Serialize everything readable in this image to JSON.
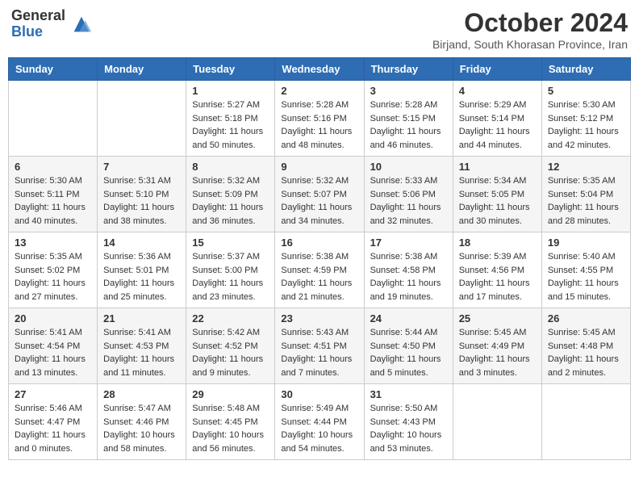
{
  "header": {
    "logo_general": "General",
    "logo_blue": "Blue",
    "month_title": "October 2024",
    "subtitle": "Birjand, South Khorasan Province, Iran"
  },
  "days_of_week": [
    "Sunday",
    "Monday",
    "Tuesday",
    "Wednesday",
    "Thursday",
    "Friday",
    "Saturday"
  ],
  "weeks": [
    [
      {
        "day": "",
        "info": ""
      },
      {
        "day": "",
        "info": ""
      },
      {
        "day": "1",
        "info": "Sunrise: 5:27 AM\nSunset: 5:18 PM\nDaylight: 11 hours and 50 minutes."
      },
      {
        "day": "2",
        "info": "Sunrise: 5:28 AM\nSunset: 5:16 PM\nDaylight: 11 hours and 48 minutes."
      },
      {
        "day": "3",
        "info": "Sunrise: 5:28 AM\nSunset: 5:15 PM\nDaylight: 11 hours and 46 minutes."
      },
      {
        "day": "4",
        "info": "Sunrise: 5:29 AM\nSunset: 5:14 PM\nDaylight: 11 hours and 44 minutes."
      },
      {
        "day": "5",
        "info": "Sunrise: 5:30 AM\nSunset: 5:12 PM\nDaylight: 11 hours and 42 minutes."
      }
    ],
    [
      {
        "day": "6",
        "info": "Sunrise: 5:30 AM\nSunset: 5:11 PM\nDaylight: 11 hours and 40 minutes."
      },
      {
        "day": "7",
        "info": "Sunrise: 5:31 AM\nSunset: 5:10 PM\nDaylight: 11 hours and 38 minutes."
      },
      {
        "day": "8",
        "info": "Sunrise: 5:32 AM\nSunset: 5:09 PM\nDaylight: 11 hours and 36 minutes."
      },
      {
        "day": "9",
        "info": "Sunrise: 5:32 AM\nSunset: 5:07 PM\nDaylight: 11 hours and 34 minutes."
      },
      {
        "day": "10",
        "info": "Sunrise: 5:33 AM\nSunset: 5:06 PM\nDaylight: 11 hours and 32 minutes."
      },
      {
        "day": "11",
        "info": "Sunrise: 5:34 AM\nSunset: 5:05 PM\nDaylight: 11 hours and 30 minutes."
      },
      {
        "day": "12",
        "info": "Sunrise: 5:35 AM\nSunset: 5:04 PM\nDaylight: 11 hours and 28 minutes."
      }
    ],
    [
      {
        "day": "13",
        "info": "Sunrise: 5:35 AM\nSunset: 5:02 PM\nDaylight: 11 hours and 27 minutes."
      },
      {
        "day": "14",
        "info": "Sunrise: 5:36 AM\nSunset: 5:01 PM\nDaylight: 11 hours and 25 minutes."
      },
      {
        "day": "15",
        "info": "Sunrise: 5:37 AM\nSunset: 5:00 PM\nDaylight: 11 hours and 23 minutes."
      },
      {
        "day": "16",
        "info": "Sunrise: 5:38 AM\nSunset: 4:59 PM\nDaylight: 11 hours and 21 minutes."
      },
      {
        "day": "17",
        "info": "Sunrise: 5:38 AM\nSunset: 4:58 PM\nDaylight: 11 hours and 19 minutes."
      },
      {
        "day": "18",
        "info": "Sunrise: 5:39 AM\nSunset: 4:56 PM\nDaylight: 11 hours and 17 minutes."
      },
      {
        "day": "19",
        "info": "Sunrise: 5:40 AM\nSunset: 4:55 PM\nDaylight: 11 hours and 15 minutes."
      }
    ],
    [
      {
        "day": "20",
        "info": "Sunrise: 5:41 AM\nSunset: 4:54 PM\nDaylight: 11 hours and 13 minutes."
      },
      {
        "day": "21",
        "info": "Sunrise: 5:41 AM\nSunset: 4:53 PM\nDaylight: 11 hours and 11 minutes."
      },
      {
        "day": "22",
        "info": "Sunrise: 5:42 AM\nSunset: 4:52 PM\nDaylight: 11 hours and 9 minutes."
      },
      {
        "day": "23",
        "info": "Sunrise: 5:43 AM\nSunset: 4:51 PM\nDaylight: 11 hours and 7 minutes."
      },
      {
        "day": "24",
        "info": "Sunrise: 5:44 AM\nSunset: 4:50 PM\nDaylight: 11 hours and 5 minutes."
      },
      {
        "day": "25",
        "info": "Sunrise: 5:45 AM\nSunset: 4:49 PM\nDaylight: 11 hours and 3 minutes."
      },
      {
        "day": "26",
        "info": "Sunrise: 5:45 AM\nSunset: 4:48 PM\nDaylight: 11 hours and 2 minutes."
      }
    ],
    [
      {
        "day": "27",
        "info": "Sunrise: 5:46 AM\nSunset: 4:47 PM\nDaylight: 11 hours and 0 minutes."
      },
      {
        "day": "28",
        "info": "Sunrise: 5:47 AM\nSunset: 4:46 PM\nDaylight: 10 hours and 58 minutes."
      },
      {
        "day": "29",
        "info": "Sunrise: 5:48 AM\nSunset: 4:45 PM\nDaylight: 10 hours and 56 minutes."
      },
      {
        "day": "30",
        "info": "Sunrise: 5:49 AM\nSunset: 4:44 PM\nDaylight: 10 hours and 54 minutes."
      },
      {
        "day": "31",
        "info": "Sunrise: 5:50 AM\nSunset: 4:43 PM\nDaylight: 10 hours and 53 minutes."
      },
      {
        "day": "",
        "info": ""
      },
      {
        "day": "",
        "info": ""
      }
    ]
  ]
}
